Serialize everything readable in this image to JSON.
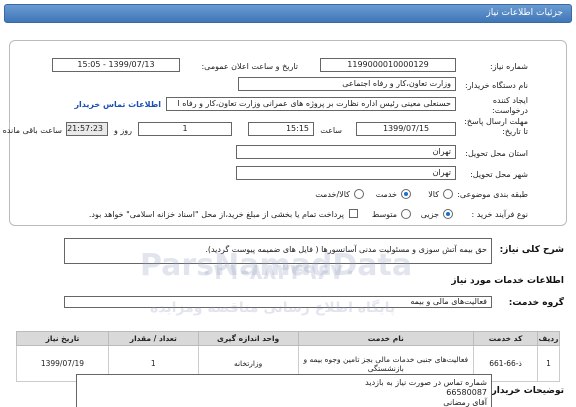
{
  "header": {
    "title": "جزئیات اطلاعات نیاز"
  },
  "form": {
    "need_number_label": "شماره نیاز:",
    "need_number": "1199000010000129",
    "announce_date_label": "تاریخ و ساعت اعلان عمومی:",
    "announce_date": "1399/07/13 - 15:05",
    "buyer_label": "نام دستگاه خریدار:",
    "buyer": "وزارت تعاون،کار و رفاه اجتماعی",
    "creator_label": "ایجاد کننده درخواست:",
    "creator": "حسنعلی معینی رئیس اداره نظارت بر پروژه های عمرانی وزارت تعاون،کار و رفاه ا",
    "contact_link": "اطلاعات تماس خریدار",
    "deadline_label": "مهلت ارسال پاسخ: تا تاریخ:",
    "deadline_date": "1399/07/15",
    "time_label": "ساعت",
    "deadline_time": "15:15",
    "days_value": "1",
    "days_label": "روز و",
    "remaining_time": "21:57:23",
    "remaining_label": "ساعت باقی مانده",
    "province_label": "استان محل تحویل:",
    "province": "تهران",
    "city_label": "شهر محل تحویل:",
    "city": "تهران",
    "category_label": "طبقه بندی موضوعی:",
    "category_options": [
      "کالا",
      "خدمت",
      "کالا/خدمت"
    ],
    "process_label": "نوع فرآیند خرید :",
    "process_options": [
      "جزیی",
      "متوسط"
    ],
    "payment_note": "پرداخت تمام یا بخشی از مبلغ خرید،از محل \"اسناد خزانه اسلامی\" خواهد بود."
  },
  "summary": {
    "label": "شرح کلی نیاز:",
    "text": "حق بیمه آتش سوزی و مسئولیت مدنی آسانسورها ( فایل های ضمیمه پیوست گردید)."
  },
  "services": {
    "section_title": "اطلاعات خدمات مورد نیاز",
    "group_label": "گروه خدمت:",
    "group_value": "فعالیت‌های مالی و بیمه"
  },
  "table": {
    "headers": [
      "ردیف",
      "کد خدمت",
      "نام خدمت",
      "واحد اندازه گیری",
      "تعداد / مقدار",
      "تاریخ نیاز"
    ],
    "rows": [
      [
        "1",
        "ذ-66-661",
        "فعالیت‌های جنبی خدمات مالی بجز تامین وجوه بیمه و بازنشستگی",
        "وزارتخانه",
        "1",
        "1399/07/19"
      ]
    ]
  },
  "notes": {
    "label": "توضیحات خریدار:",
    "lines": [
      "شماره تماس در صورت نیاز به بازدید",
      "66580087",
      "آقای رمضانی"
    ]
  },
  "watermark": {
    "line1": "ParsNamadData",
    "line2": "پایگاه اطلاع رسانی مناقصه ومزایده",
    "line3": "۰۲۱-۸۸۳۴۹۶۷۰"
  }
}
